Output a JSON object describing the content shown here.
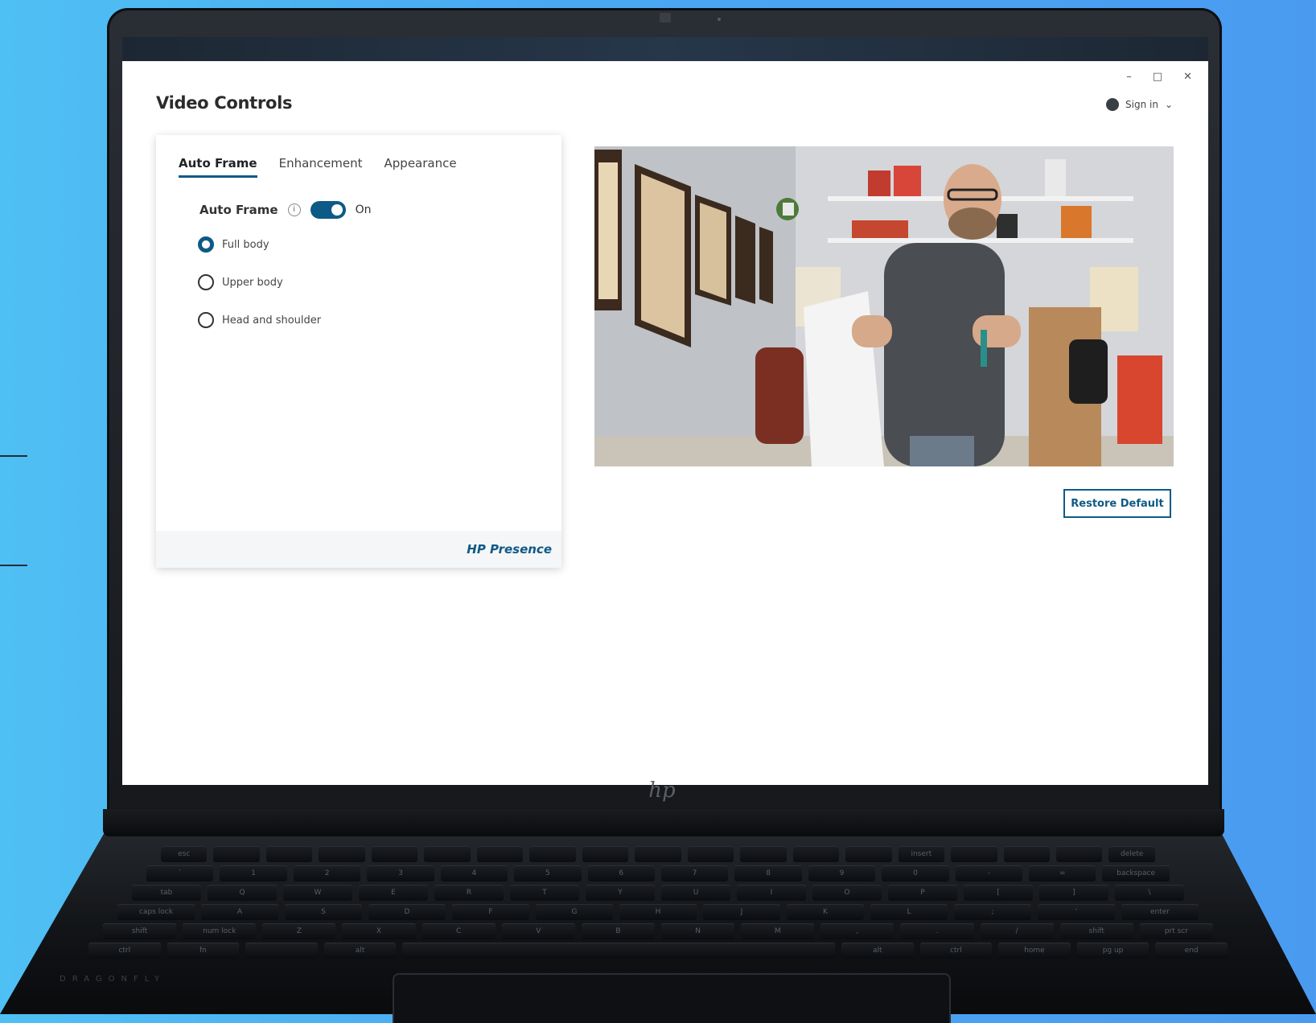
{
  "window": {
    "title": "Video Controls",
    "minimize_glyph": "–",
    "maximize_glyph": "□",
    "close_glyph": "✕"
  },
  "account": {
    "signin_label": "Sign in",
    "chevron_glyph": "⌄"
  },
  "tabs": [
    {
      "label": "Auto Frame",
      "active": true
    },
    {
      "label": "Enhancement",
      "active": false
    },
    {
      "label": "Appearance",
      "active": false
    }
  ],
  "auto_frame": {
    "label": "Auto Frame",
    "info_glyph": "i",
    "toggle_state": "On",
    "enabled": true,
    "options": [
      {
        "label": "Full body",
        "checked": true
      },
      {
        "label": "Upper body",
        "checked": false
      },
      {
        "label": "Head and shoulder",
        "checked": false
      }
    ]
  },
  "footer": {
    "brand": "HP Presence"
  },
  "preview": {
    "restore_label": "Restore Default"
  },
  "device": {
    "lid_logo": "hp",
    "model_text": "DRAGONFLY"
  },
  "keyboard": {
    "rows": [
      [
        "esc",
        "",
        "",
        "",
        "",
        "",
        "",
        "",
        "",
        "",
        "",
        "",
        "",
        "",
        "insert",
        "",
        "",
        "",
        "delete"
      ],
      [
        "`",
        "1",
        "2",
        "3",
        "4",
        "5",
        "6",
        "7",
        "8",
        "9",
        "0",
        "-",
        "=",
        "backspace"
      ],
      [
        "tab",
        "Q",
        "W",
        "E",
        "R",
        "T",
        "Y",
        "U",
        "I",
        "O",
        "P",
        "[",
        "]",
        "\\"
      ],
      [
        "caps lock",
        "A",
        "S",
        "D",
        "F",
        "G",
        "H",
        "J",
        "K",
        "L",
        ";",
        "'",
        "enter"
      ],
      [
        "shift",
        "num lock",
        "Z",
        "X",
        "C",
        "V",
        "B",
        "N",
        "M",
        ",",
        ".",
        "/",
        "shift",
        "prt scr"
      ],
      [
        "ctrl",
        "fn",
        "",
        "alt",
        "",
        "alt",
        "ctrl",
        "home",
        "pg up",
        "end"
      ]
    ]
  },
  "colors": {
    "accent": "#0e5a86",
    "background": "#4aa9f2"
  }
}
